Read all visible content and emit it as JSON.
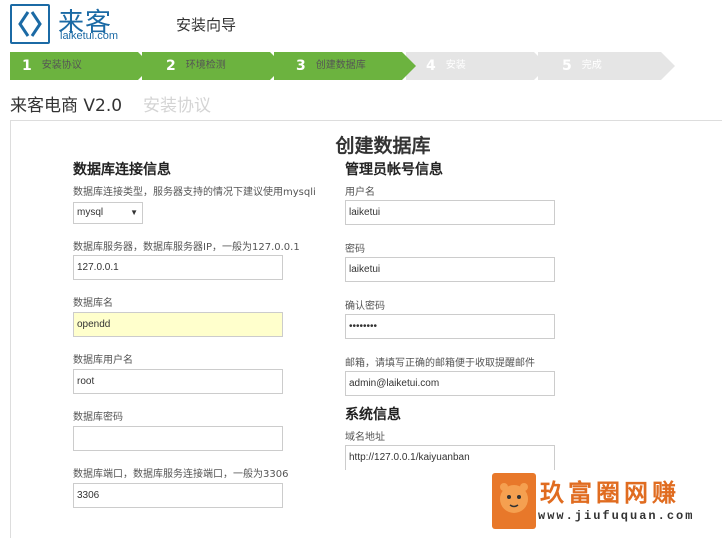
{
  "header": {
    "logo_cn": "来客",
    "logo_en": "laiketui.com",
    "wizard_title": "安装向导"
  },
  "steps": [
    {
      "num": "1",
      "label": "安装协议",
      "state": "done"
    },
    {
      "num": "2",
      "label": "环境检测",
      "state": "done"
    },
    {
      "num": "3",
      "label": "创建数据库",
      "state": "done"
    },
    {
      "num": "4",
      "label": "安装",
      "state": "todo"
    },
    {
      "num": "5",
      "label": "完成",
      "state": "todo"
    }
  ],
  "app": {
    "name": "来客电商 V2.0",
    "subtitle": "安装协议"
  },
  "panel": {
    "title": "创建数据库"
  },
  "db": {
    "section_title": "数据库连接信息",
    "type_label": "数据库连接类型，服务器支持的情况下建议使用mysqli",
    "type_value": "mysql",
    "host_label": "数据库服务器，数据库服务器IP，一般为127.0.0.1",
    "host_value": "127.0.0.1",
    "name_label": "数据库名",
    "name_value": "opendd",
    "user_label": "数据库用户名",
    "user_value": "root",
    "pass_label": "数据库密码",
    "pass_value": "",
    "port_label": "数据库端口，数据库服务连接端口，一般为3306",
    "port_value": "3306"
  },
  "admin": {
    "section_title": "管理员帐号信息",
    "user_label": "用户名",
    "user_value": "laiketui",
    "pass_label": "密码",
    "pass_value": "laiketui",
    "confirm_label": "确认密码",
    "confirm_value": "••••••••",
    "email_label": "邮箱，请填写正确的邮箱便于收取提醒邮件",
    "email_value": "admin@laiketui.com"
  },
  "system": {
    "section_title": "系统信息",
    "domain_label": "域名地址",
    "domain_value": "http://127.0.0.1/kaiyuanban"
  },
  "watermark": {
    "text": "玖富圈网赚",
    "url": "www.jiufuquan.com"
  },
  "colors": {
    "brand": "#1b6aa5",
    "step_done": "#6cb33f",
    "step_todo": "#e5e5e5",
    "highlight": "#ffffcc",
    "watermark": "#e06c20"
  }
}
